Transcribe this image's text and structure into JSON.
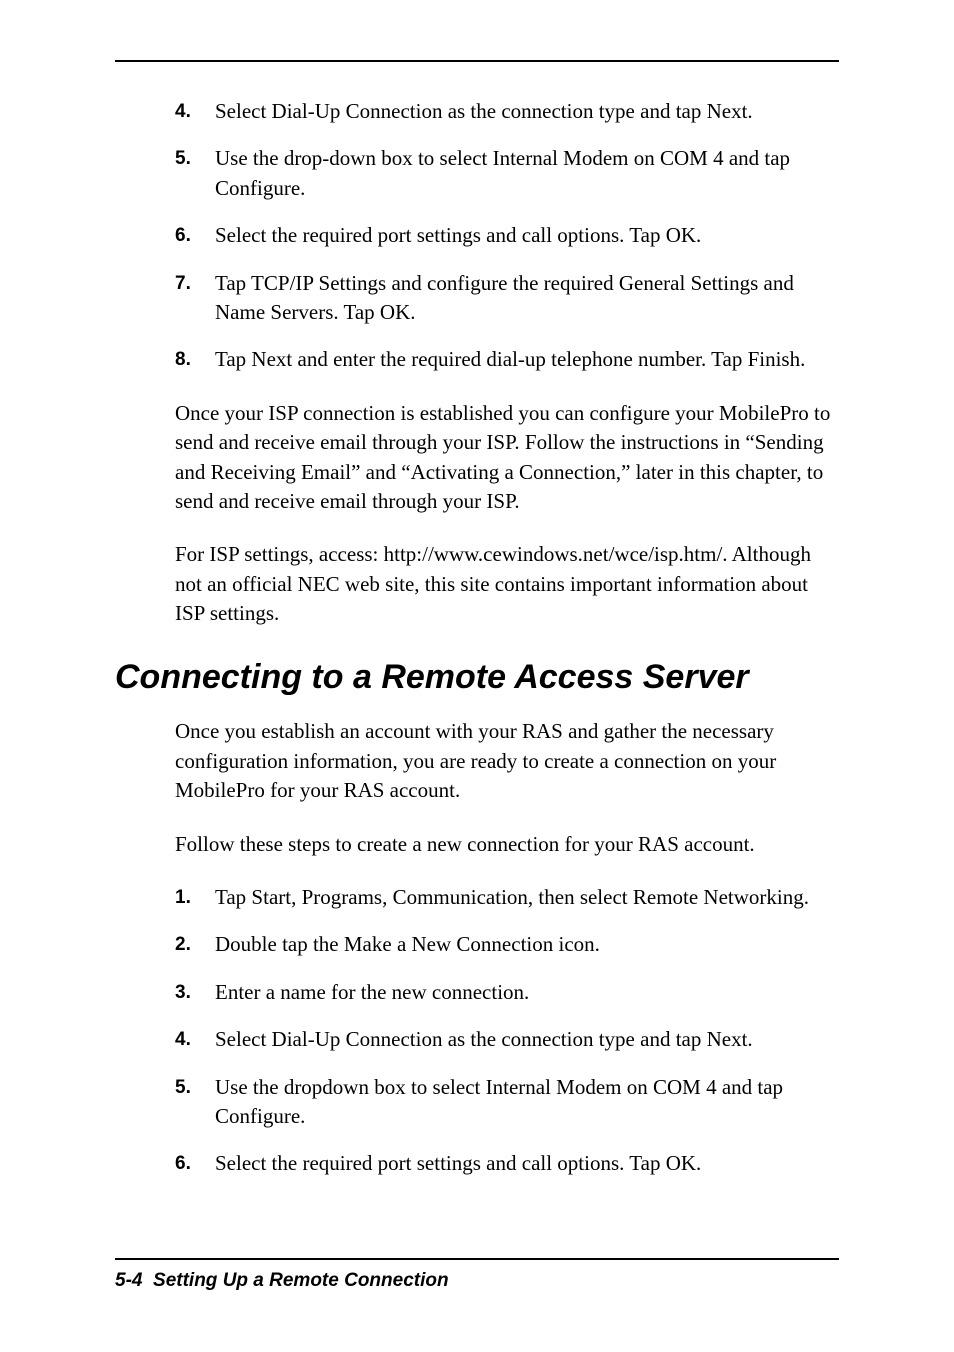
{
  "list1": {
    "items": [
      {
        "num": "4.",
        "text": "Select Dial-Up Connection as the connection type and tap Next."
      },
      {
        "num": "5.",
        "text": "Use the drop-down box to select Internal Modem on COM 4 and tap Configure."
      },
      {
        "num": "6.",
        "text": "Select the required port settings and call options. Tap OK."
      },
      {
        "num": "7.",
        "text": "Tap TCP/IP Settings and configure the required General Settings and Name Servers. Tap OK."
      },
      {
        "num": "8.",
        "text": "Tap Next and enter the required dial-up telephone number. Tap Finish."
      }
    ]
  },
  "para1": "Once your ISP connection is established you can configure your MobilePro to send and receive email through your ISP. Follow the instructions in “Sending and Receiving Email” and “Activating a Connection,” later in this chapter, to send and receive email through your ISP.",
  "para2": "For ISP settings, access: http://www.cewindows.net/wce/isp.htm/. Although not an official NEC web site, this site contains important information about ISP settings.",
  "heading": "Connecting to a Remote Access Server",
  "para3": "Once you establish an account with your RAS and gather the necessary configuration information, you are ready to create a connection on your MobilePro for your RAS account.",
  "para4": "Follow these steps to create a new connection for your RAS account.",
  "list2": {
    "items": [
      {
        "num": "1.",
        "text": "Tap Start, Programs, Communication, then select Remote Networking."
      },
      {
        "num": "2.",
        "text": "Double tap the Make a New Connection icon."
      },
      {
        "num": "3.",
        "text": "Enter a name for the new connection."
      },
      {
        "num": "4.",
        "text": "Select Dial-Up Connection as the connection type and tap Next."
      },
      {
        "num": "5.",
        "text": "Use the dropdown box to select Internal Modem on COM 4 and tap Configure."
      },
      {
        "num": "6.",
        "text": "Select the required port settings and call options. Tap OK."
      }
    ]
  },
  "footer": {
    "pageNum": "5-4",
    "title": "Setting Up a Remote Connection"
  }
}
